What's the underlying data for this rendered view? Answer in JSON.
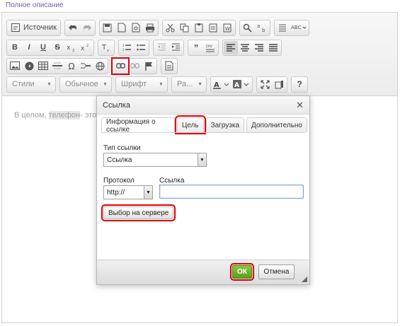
{
  "field_label": "Полное описание",
  "toolbar": {
    "source_label": "Источник",
    "styles_label": "Стили",
    "format_label": "Обычное",
    "font_label": "Шрифт",
    "size_label": "Ра..."
  },
  "content": {
    "text_before": "В целом, ",
    "text_marked": "телефон",
    "text_after": "- это с"
  },
  "dialog": {
    "title": "Ссылка",
    "tabs": [
      {
        "label": "Информация о ссылке",
        "active": true
      },
      {
        "label": "Цель",
        "active": false
      },
      {
        "label": "Загрузка",
        "active": false
      },
      {
        "label": "Дополнительно",
        "active": false
      }
    ],
    "link_type_label": "Тип ссылки",
    "link_type_value": "Ссылка",
    "protocol_label": "Протокол",
    "protocol_value": "http://",
    "url_label": "Ссылка",
    "url_value": "",
    "server_browse_label": "Выбор на сервере",
    "ok_label": "ОК",
    "cancel_label": "Отмена"
  },
  "colors": {
    "highlight": "#e0000a",
    "ok_green": "#6aaa28",
    "label_purple": "#7a5fa6"
  }
}
